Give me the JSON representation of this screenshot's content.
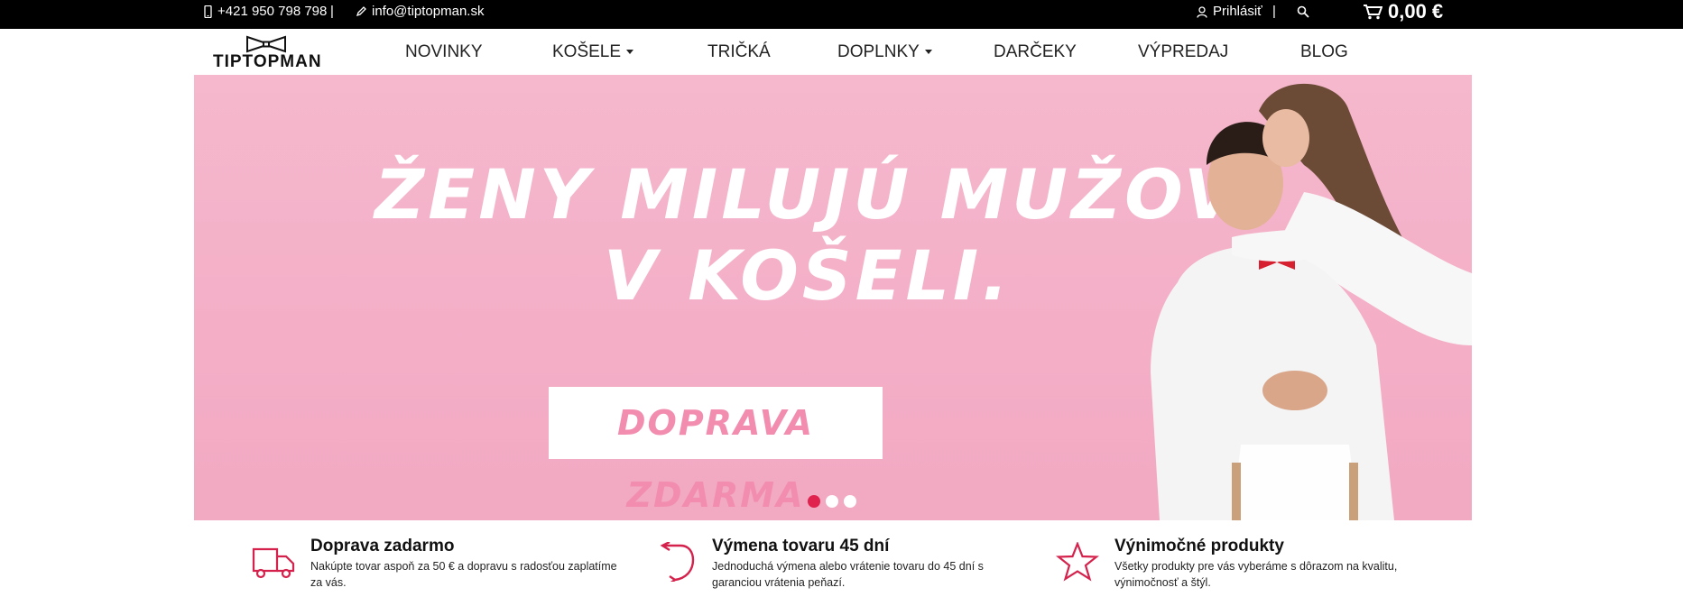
{
  "topbar": {
    "phone": "+421 950 798 798",
    "separator": "|",
    "email": "info@tiptopman.sk",
    "login_label": "Prihlásiť",
    "cart_total": "0,00 €"
  },
  "logo": {
    "text": "TIPTOPMAN"
  },
  "nav": {
    "items": [
      {
        "label": "NOVINKY"
      },
      {
        "label": "KOŠELE"
      },
      {
        "label": "TRIČKÁ"
      },
      {
        "label": "DOPLNKY"
      },
      {
        "label": "DARČEKY"
      },
      {
        "label": "VÝPREDAJ"
      },
      {
        "label": "BLOG"
      }
    ]
  },
  "hero": {
    "headline_line1": "ŽENY MILUJÚ MUŽOV",
    "headline_line2": "V KOŠELI.",
    "cta_label": "DOPRAVA ZDARMA",
    "slide_count": 3,
    "active_slide": 1
  },
  "features": [
    {
      "icon": "truck-icon",
      "title": "Doprava zadarmo",
      "desc": "Nakúpte tovar aspoň za 50 € a dopravu s radosťou zaplatíme za vás."
    },
    {
      "icon": "return-arrow-icon",
      "title": "Výmena tovaru 45 dní",
      "desc": "Jednoduchá výmena alebo vrátenie tovaru do 45 dní s garanciou vrátenia peňazí."
    },
    {
      "icon": "star-icon",
      "title": "Výnimočné produkty",
      "desc": "Všetky produkty pre vás vyberáme s dôrazom na kvalitu, výnimočnosť a štýl."
    }
  ],
  "colors": {
    "accent": "#e0224f",
    "hero_bg": "#f4afc7",
    "cta_text": "#f28db0",
    "topbar_bg": "#000000"
  }
}
